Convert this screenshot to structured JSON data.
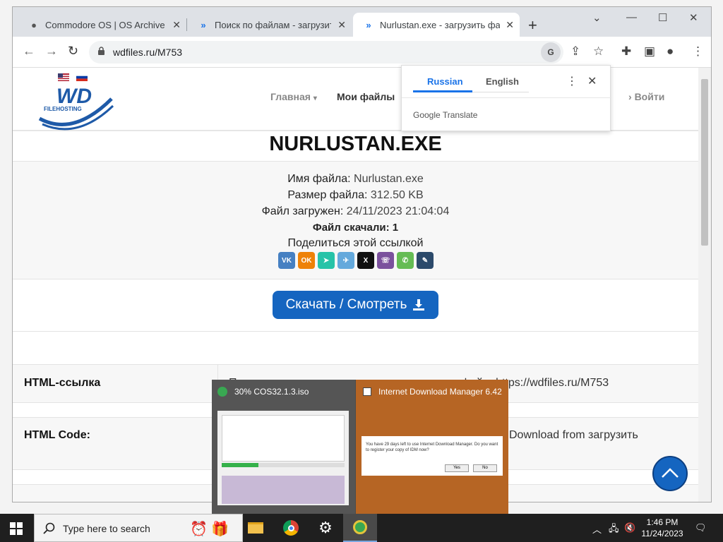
{
  "browser": {
    "tabs": [
      {
        "title": "Commodore OS | OS Archive",
        "active": false
      },
      {
        "title": "Поиск по файлам - загрузить ф",
        "active": false
      },
      {
        "title": "Nurlustan.exe - загрузить файл",
        "active": true
      }
    ],
    "url": "wdfiles.ru/M753"
  },
  "translate_popup": {
    "lang_source": "Russian",
    "lang_target": "English",
    "footer": "Google Translate"
  },
  "site": {
    "logo_text": "WD",
    "logo_sub": "FILEHOSTING",
    "nav_home": "Главная",
    "nav_files": "Мои файлы",
    "nav_login": "Войти"
  },
  "file": {
    "title": "NURLUSTAN.EXE",
    "name_label": "Имя файла:",
    "name_value": "Nurlustan.exe",
    "size_label": "Размер файла:",
    "size_value": "312.50 KB",
    "uploaded_label": "Файл загружен:",
    "uploaded_value": "24/11/2023 21:04:04",
    "downloads_text": "Файл скачали: 1",
    "share_text": "Поделиться этой ссылкой",
    "download_button": "Скачать / Смотреть"
  },
  "links": [
    {
      "label": "HTML-ссылка",
      "value": "Постоянная ссылка для скачивания на этот файл: https://wdfiles.ru/M753"
    },
    {
      "label": "HTML Code:",
      "value": "Download from загрузить"
    }
  ],
  "taskbar": {
    "search_placeholder": "Type here to search",
    "time": "1:46 PM",
    "date": "11/24/2023"
  },
  "thumbnails": {
    "idm_download_title": "30% COS32.1.3.iso",
    "idm_app_title": "Internet Download Manager 6.42",
    "idm_msg": "You have 29 days left to use Internet Download Manager. Do you want to register your copy of IDM now?",
    "yes": "Yes",
    "no": "No"
  },
  "colors": {
    "accent": "#1565c0",
    "chrome_tab_bg": "#dee1e6",
    "idm_orange": "#b66524"
  }
}
